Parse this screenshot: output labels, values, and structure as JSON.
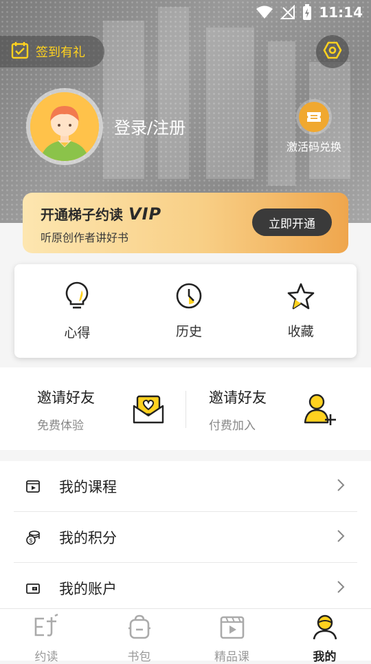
{
  "status_bar": {
    "time": "11:14"
  },
  "header": {
    "checkin_label": "签到有礼",
    "login_label": "登录/注册",
    "redeem_label": "激活码兑换"
  },
  "vip_banner": {
    "title": "开通梯子约读",
    "vip_word": "VIP",
    "subtitle": "听原创作者讲好书",
    "button_label": "立即开通"
  },
  "quick_actions": [
    {
      "label": "心得",
      "icon": "lightbulb-icon"
    },
    {
      "label": "历史",
      "icon": "clock-icon"
    },
    {
      "label": "收藏",
      "icon": "star-icon"
    }
  ],
  "invite": {
    "left": {
      "title": "邀请好友",
      "subtitle": "免费体验",
      "icon": "gift-envelope-icon"
    },
    "right": {
      "title": "邀请好友",
      "subtitle": "付费加入",
      "icon": "add-user-icon"
    }
  },
  "menu": [
    {
      "label": "我的课程",
      "icon": "course-icon"
    },
    {
      "label": "我的积分",
      "icon": "points-icon"
    },
    {
      "label": "我的账户",
      "icon": "wallet-icon"
    }
  ],
  "bottom_nav": [
    {
      "label": "约读",
      "icon": "read-icon",
      "active": false
    },
    {
      "label": "书包",
      "icon": "bag-icon",
      "active": false
    },
    {
      "label": "精品课",
      "icon": "video-icon",
      "active": false
    },
    {
      "label": "我的",
      "icon": "profile-icon",
      "active": true
    }
  ],
  "colors": {
    "accent": "#ffd21f",
    "dark": "#3a3a3a"
  }
}
